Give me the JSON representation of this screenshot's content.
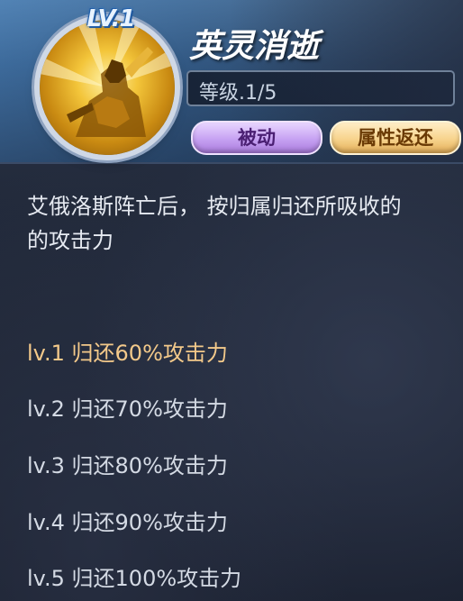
{
  "skill": {
    "level_badge": "LV.1",
    "name": "英灵消逝",
    "level_text": "等级.1/5",
    "tags": {
      "passive": "被动",
      "attribute_return": "属性返还"
    },
    "icon": "golden-saint-warrior-icon"
  },
  "description": {
    "line1": "艾俄洛斯阵亡后， 按归属归还所吸收的",
    "line2": "的攻击力"
  },
  "levels": [
    {
      "label": "lv.1 归还60%攻击力",
      "active": true
    },
    {
      "label": "lv.2 归还70%攻击力",
      "active": false
    },
    {
      "label": "lv.3 归还80%攻击力",
      "active": false
    },
    {
      "label": "lv.4 归还90%攻击力",
      "active": false
    },
    {
      "label": "lv.5 归还100%攻击力",
      "active": false
    }
  ],
  "colors": {
    "active_level": "#f3c98a",
    "inactive_level": "#d4dae4",
    "passive_tag": "#c6a1f2",
    "return_tag": "#f7d38c"
  }
}
